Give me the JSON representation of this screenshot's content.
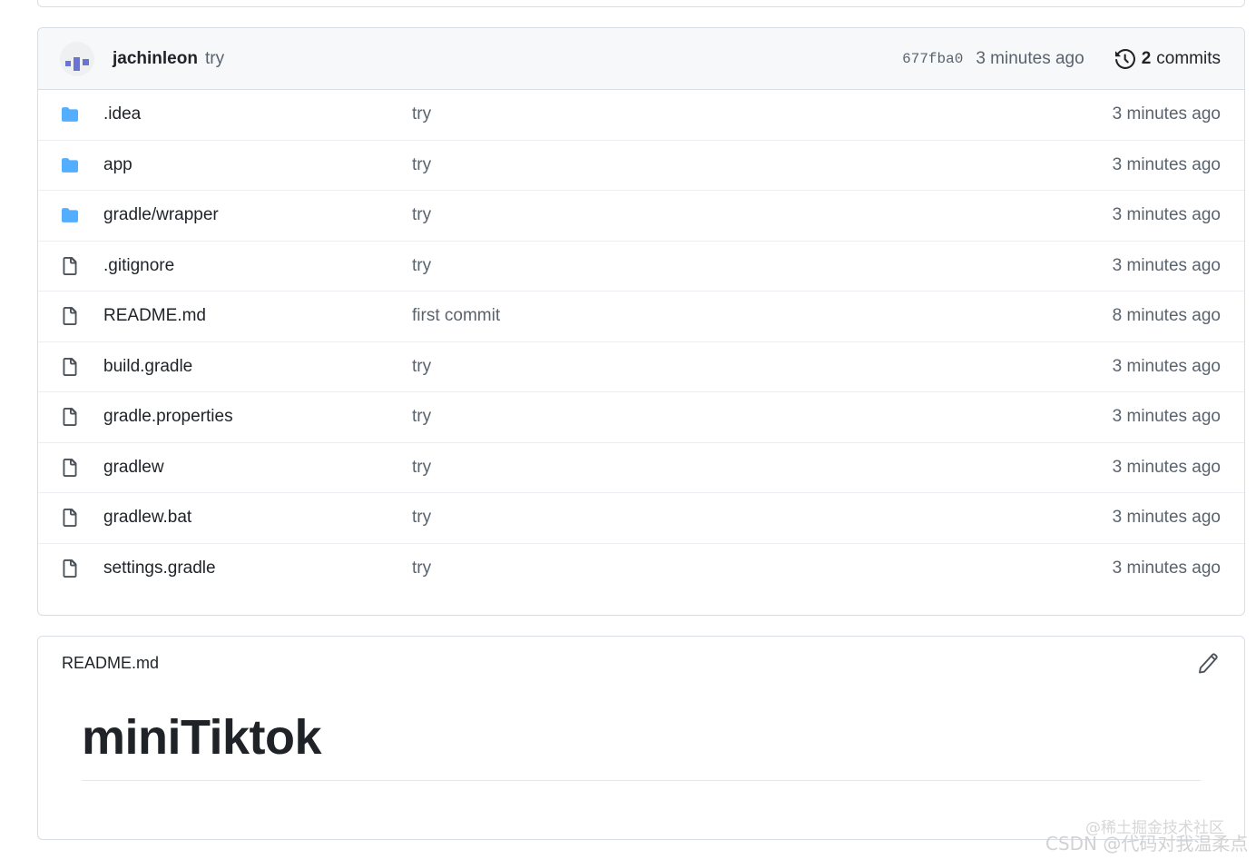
{
  "latest_commit": {
    "author": "jachinleon",
    "message": "try",
    "sha": "677fba0",
    "relative_time": "3 minutes ago",
    "commits_count": "2",
    "commits_word": "commits",
    "history_icon": "history-icon",
    "avatar_icon": "user-avatar"
  },
  "files": [
    {
      "icon": "folder-icon",
      "type": "folder",
      "name": ".idea",
      "commit": "try",
      "time": "3 minutes ago"
    },
    {
      "icon": "folder-icon",
      "type": "folder",
      "name": "app",
      "commit": "try",
      "time": "3 minutes ago"
    },
    {
      "icon": "folder-icon",
      "type": "folder",
      "name": "gradle/wrapper",
      "commit": "try",
      "time": "3 minutes ago"
    },
    {
      "icon": "file-icon",
      "type": "file",
      "name": ".gitignore",
      "commit": "try",
      "time": "3 minutes ago"
    },
    {
      "icon": "file-icon",
      "type": "file",
      "name": "README.md",
      "commit": "first commit",
      "time": "8 minutes ago"
    },
    {
      "icon": "file-icon",
      "type": "file",
      "name": "build.gradle",
      "commit": "try",
      "time": "3 minutes ago"
    },
    {
      "icon": "file-icon",
      "type": "file",
      "name": "gradle.properties",
      "commit": "try",
      "time": "3 minutes ago"
    },
    {
      "icon": "file-icon",
      "type": "file",
      "name": "gradlew",
      "commit": "try",
      "time": "3 minutes ago"
    },
    {
      "icon": "file-icon",
      "type": "file",
      "name": "gradlew.bat",
      "commit": "try",
      "time": "3 minutes ago"
    },
    {
      "icon": "file-icon",
      "type": "file",
      "name": "settings.gradle",
      "commit": "try",
      "time": "3 minutes ago"
    }
  ],
  "readme": {
    "title": "README.md",
    "edit_icon": "pencil-icon",
    "heading": "miniTiktok"
  },
  "watermarks": {
    "line1": "@稀土掘金技术社区",
    "line2": "CSDN @代码对我温柔点"
  },
  "colors": {
    "folder_blue": "#54aeff",
    "panel_border": "#d8dee4",
    "header_bg": "#f6f8fa",
    "text_primary": "#1f2328",
    "text_muted": "#59636e"
  }
}
